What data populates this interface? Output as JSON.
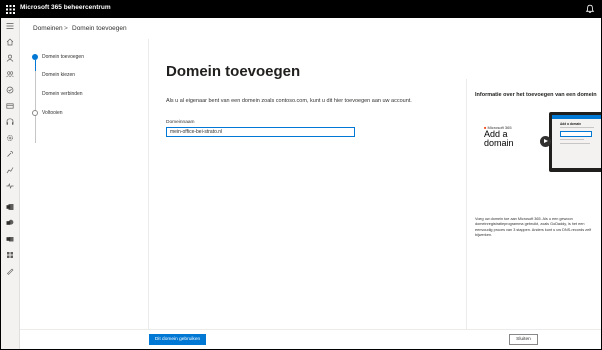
{
  "app": {
    "title": "Microsoft 365 beheercentrum"
  },
  "breadcrumb": {
    "items": [
      "Domeinen",
      "Domein toevoegen"
    ],
    "separator": ">"
  },
  "steps": [
    {
      "label": "Domein toevoegen",
      "state": "active"
    },
    {
      "label": "Domein kiezen",
      "state": "todo"
    },
    {
      "label": "Domein verbinden",
      "state": "todo"
    },
    {
      "label": "Voltooien",
      "state": "todo"
    }
  ],
  "main": {
    "title": "Domein toevoegen",
    "intro": "Als u al eigenaar bent van een domein zoals contoso.com, kunt u dit hier toevoegen aan uw account.",
    "field_label": "Domeinnaam",
    "field_value": "mein-office-bei-strato.nl"
  },
  "sidebar": {
    "heading": "Informatie over het toevoegen van een domein",
    "video": {
      "brand": "Microsoft 365",
      "title_line1": "Add a",
      "title_line2": "domain",
      "screen_title": "Add a domain"
    },
    "description": "Voeg uw domein toe aan Microsoft 365. Als u een gewoon domeinregistratieprogramma gebruikt, zoals GoDaddy, is het een eenvoudig proces van 3 stappen. Anders kunt u uw DNS-records zelf bijwerken."
  },
  "footer": {
    "primary_label": "Dit domein gebruiken",
    "close_label": "Sluiten"
  },
  "icons": [
    "waffle-icon",
    "bell-icon",
    "menu-icon",
    "home-icon",
    "user-icon",
    "groups-icon",
    "roles-icon",
    "billing-icon",
    "support-icon",
    "settings-icon",
    "setup-icon",
    "reports-icon",
    "health-icon",
    "exchange-icon",
    "sharepoint-icon",
    "teams-icon",
    "all-admin-centers-icon"
  ],
  "colors": {
    "accent": "#0078d4",
    "topbar": "#000000",
    "nav": "#f3f2f1"
  }
}
